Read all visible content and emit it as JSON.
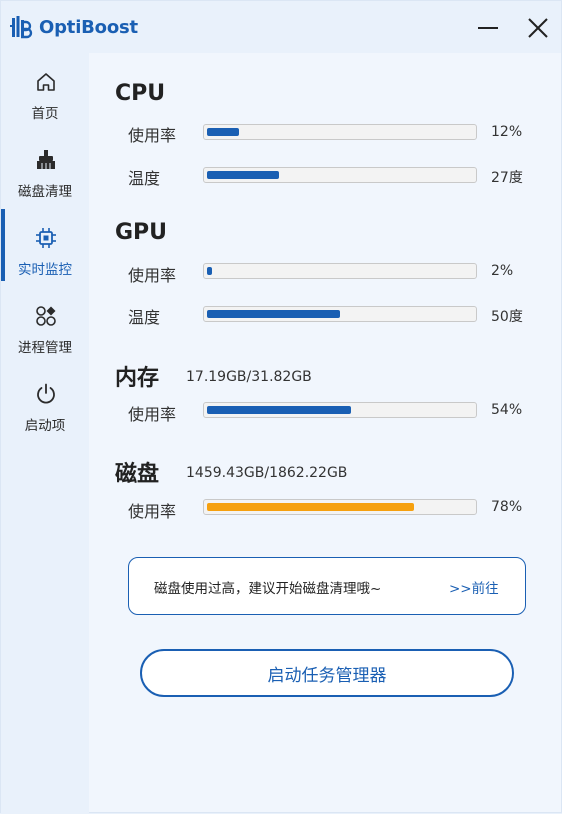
{
  "app": {
    "title": "OptiBoost",
    "accent": "#1a5fb3",
    "warning": "#f6a00e"
  },
  "window_controls": {
    "minimize_icon": "minimize-icon",
    "close_icon": "close-icon"
  },
  "sidebar": {
    "items": [
      {
        "label": "首页",
        "icon": "home-icon",
        "active": false
      },
      {
        "label": "磁盘清理",
        "icon": "broom-icon",
        "active": false
      },
      {
        "label": "实时监控",
        "icon": "cpu-chip-icon",
        "active": true
      },
      {
        "label": "进程管理",
        "icon": "apps-icon",
        "active": false
      },
      {
        "label": "启动项",
        "icon": "power-icon",
        "active": false
      }
    ]
  },
  "monitor": {
    "cpu": {
      "title": "CPU",
      "usage_label": "使用率",
      "usage_value": "12%",
      "usage_fraction": 0.12,
      "temp_label": "温度",
      "temp_value": "27度",
      "temp_fraction": 0.27
    },
    "gpu": {
      "title": "GPU",
      "usage_label": "使用率",
      "usage_value": "2%",
      "usage_fraction": 0.02,
      "temp_label": "温度",
      "temp_value": "50度",
      "temp_fraction": 0.5
    },
    "memory": {
      "title": "内存",
      "detail": "17.19GB/31.82GB",
      "usage_label": "使用率",
      "usage_value": "54%",
      "usage_fraction": 0.54
    },
    "disk": {
      "title": "磁盘",
      "detail": "1459.43GB/1862.22GB",
      "usage_label": "使用率",
      "usage_value": "78%",
      "usage_fraction": 0.78
    }
  },
  "alert": {
    "message": "磁盘使用过高，建议开始磁盘清理哦~",
    "link_label": ">>前往"
  },
  "actions": {
    "launch_task_manager": "启动任务管理器"
  }
}
